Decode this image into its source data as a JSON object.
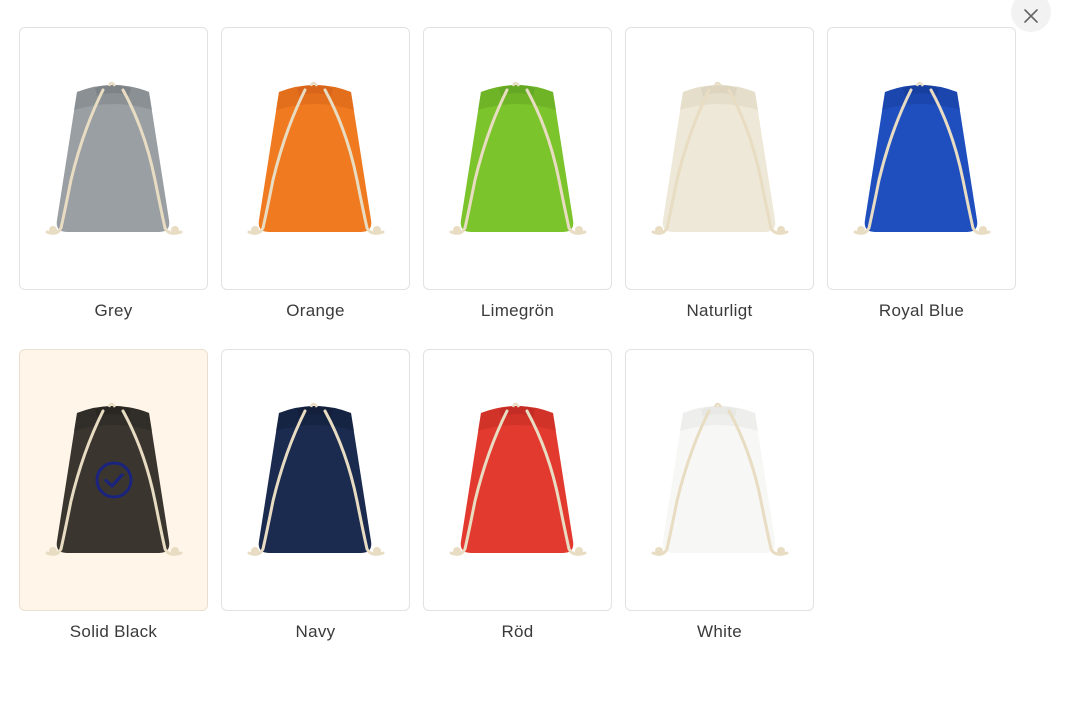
{
  "close_icon": "close-icon",
  "swatches": [
    {
      "label": "Grey",
      "color": "#9a9fa3",
      "shade": "#7e8387",
      "selected": false
    },
    {
      "label": "Orange",
      "color": "#f07a1f",
      "shade": "#d8651a",
      "selected": false
    },
    {
      "label": "Limegrön",
      "color": "#7cc42c",
      "shade": "#65a823",
      "selected": false
    },
    {
      "label": "Naturligt",
      "color": "#eee8d8",
      "shade": "#ddd5c0",
      "selected": false
    },
    {
      "label": "Royal Blue",
      "color": "#1f4fbf",
      "shade": "#173f9f",
      "selected": false
    },
    {
      "label": "Solid Black",
      "color": "#3a362f",
      "shade": "#2a2722",
      "selected": true
    },
    {
      "label": "Navy",
      "color": "#1b2a4f",
      "shade": "#131f3b",
      "selected": false
    },
    {
      "label": "Röd",
      "color": "#e33a30",
      "shade": "#c42d25",
      "selected": false
    },
    {
      "label": "White",
      "color": "#f7f7f5",
      "shade": "#e8e8e4",
      "selected": false
    }
  ],
  "selected_check_icon": "check-circle-icon",
  "accent_color": "#1a237e"
}
